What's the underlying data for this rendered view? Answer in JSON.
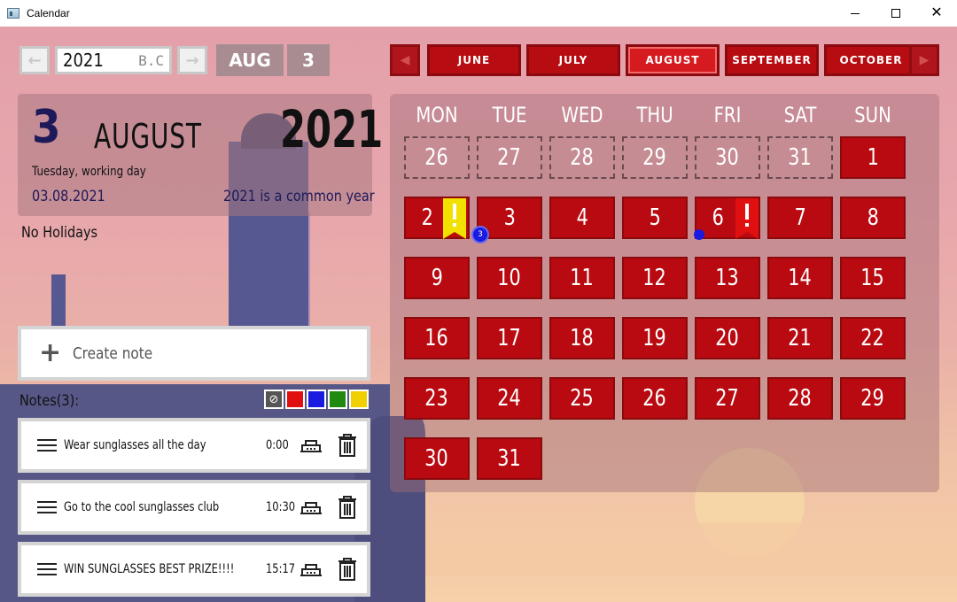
{
  "window": {
    "title": "Calendar"
  },
  "nav": {
    "prev_year_icon": "arrow-left-icon",
    "next_year_icon": "arrow-right-icon",
    "year": "2021",
    "era": "B.C",
    "month_chip": "AUG",
    "day_chip": "3"
  },
  "info": {
    "day": "3",
    "month": "AUGUST",
    "year": "2021",
    "weekday_text": "Tuesday, working day",
    "date": "03.08.2021",
    "year_type": "2021 is a common year",
    "holidays": "No Holidays"
  },
  "notes": {
    "create_label": "Create note",
    "title": "Notes(3):",
    "filters": [
      "#e01010",
      "#1a1ae0",
      "#208a10",
      "#f0d000"
    ],
    "items": [
      {
        "text": "Wear sunglasses all the day",
        "time": "0:00"
      },
      {
        "text": "Go to the cool sunglasses club",
        "time": "10:30"
      },
      {
        "text": "WIN SUNGLASSES BEST PRIZE!!!!",
        "time": "15:17"
      }
    ]
  },
  "month_tabs": [
    "JUNE",
    "JULY",
    "AUGUST",
    "SEPTEMBER",
    "OCTOBER"
  ],
  "active_month": "AUGUST",
  "weekdays": [
    "MON",
    "TUE",
    "WED",
    "THU",
    "FRI",
    "SAT",
    "SUN"
  ],
  "calendar": {
    "prev_month_days": [
      "26",
      "27",
      "28",
      "29",
      "30",
      "31"
    ],
    "days": [
      "1",
      "2",
      "3",
      "4",
      "5",
      "6",
      "7",
      "8",
      "9",
      "10",
      "11",
      "12",
      "13",
      "14",
      "15",
      "16",
      "17",
      "18",
      "19",
      "20",
      "21",
      "22",
      "23",
      "24",
      "25",
      "26",
      "27",
      "28",
      "29",
      "30",
      "31"
    ],
    "markers": {
      "day_2_flag_color": "#f2e000",
      "day_6_flag_color": "#e01010",
      "day_2_note_count": "3"
    }
  },
  "colors": {
    "accent_red": "#b80a10",
    "dark_blue": "#1e1a5a"
  }
}
